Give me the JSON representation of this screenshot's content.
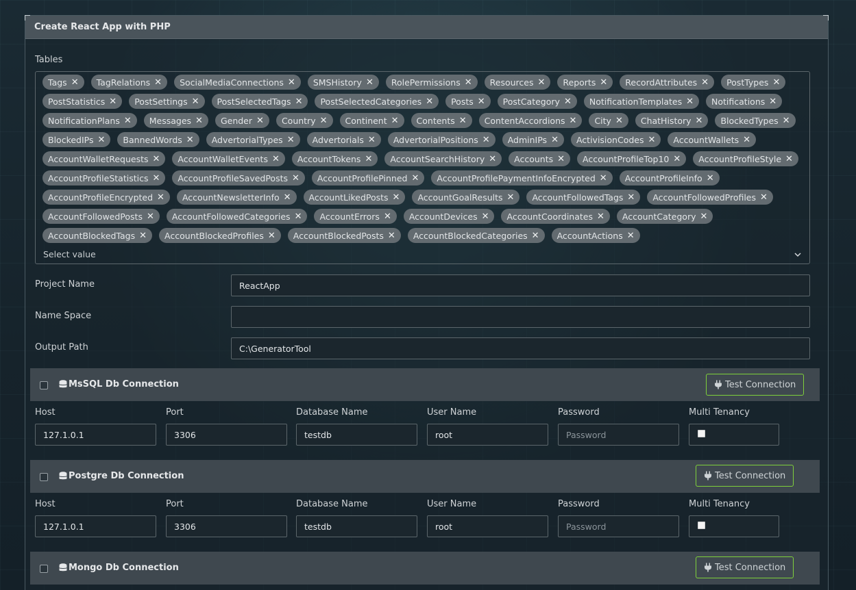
{
  "panel": {
    "title": "Create React App with PHP"
  },
  "tables": {
    "label": "Tables",
    "placeholder": "Select value",
    "selected": [
      "Tags",
      "TagRelations",
      "SocialMediaConnections",
      "SMSHistory",
      "RolePermissions",
      "Resources",
      "Reports",
      "RecordAttributes",
      "PostTypes",
      "PostStatistics",
      "PostSettings",
      "PostSelectedTags",
      "PostSelectedCategories",
      "Posts",
      "PostCategory",
      "NotificationTemplates",
      "Notifications",
      "NotificationPlans",
      "Messages",
      "Gender",
      "Country",
      "Continent",
      "Contents",
      "ContentAccordions",
      "City",
      "ChatHistory",
      "BlockedTypes",
      "BlockedIPs",
      "BannedWords",
      "AdvertorialTypes",
      "Advertorials",
      "AdvertorialPositions",
      "AdminIPs",
      "ActivisionCodes",
      "AccountWallets",
      "AccountWalletRequests",
      "AccountWalletEvents",
      "AccountTokens",
      "AccountSearchHistory",
      "Accounts",
      "AccountProfileTop10",
      "AccountProfileStyle",
      "AccountProfileStatistics",
      "AccountProfileSavedPosts",
      "AccountProfilePinned",
      "AccountProfilePaymentInfoEncrypted",
      "AccountProfileInfo",
      "AccountProfileEncrypted",
      "AccountNewsletterInfo",
      "AccountLikedPosts",
      "AccountGoalResults",
      "AccountFollowedTags",
      "AccountFollowedProfiles",
      "AccountFollowedPosts",
      "AccountFollowedCategories",
      "AccountErrors",
      "AccountDevices",
      "AccountCoordinates",
      "AccountCategory",
      "AccountBlockedTags",
      "AccountBlockedProfiles",
      "AccountBlockedPosts",
      "AccountBlockedCategories",
      "AccountActions"
    ]
  },
  "project": {
    "name_label": "Project Name",
    "name_value": "ReactApp",
    "namespace_label": "Name Space",
    "namespace_value": "",
    "output_label": "Output Path",
    "output_value": "C:\\GeneratorTool"
  },
  "labels": {
    "host": "Host",
    "port": "Port",
    "database": "Database Name",
    "user": "User Name",
    "password": "Password",
    "tenancy": "Multi Tenancy",
    "password_placeholder": "Password",
    "test_button": "Test Connection"
  },
  "connections": {
    "mssql": {
      "title": "MsSQL Db Connection",
      "host": "127.1.0.1",
      "port": "3306",
      "database": "testdb",
      "user": "root",
      "password": "",
      "multi_tenancy": true
    },
    "postgre": {
      "title": "Postgre Db Connection",
      "host": "127.1.0.1",
      "port": "3306",
      "database": "testdb",
      "user": "root",
      "password": "",
      "multi_tenancy": true
    },
    "mongo": {
      "title": "Mongo Db Connection"
    }
  },
  "colors": {
    "accent_green": "#7fd13b",
    "chip_bg": "#636b70",
    "header_bg": "#4a545b",
    "db_header_bg": "#3f484f"
  },
  "icons": {
    "chip_remove": "close-icon",
    "select_toggle": "chevron-down-icon",
    "db": "database-icon",
    "test": "plug-icon"
  }
}
